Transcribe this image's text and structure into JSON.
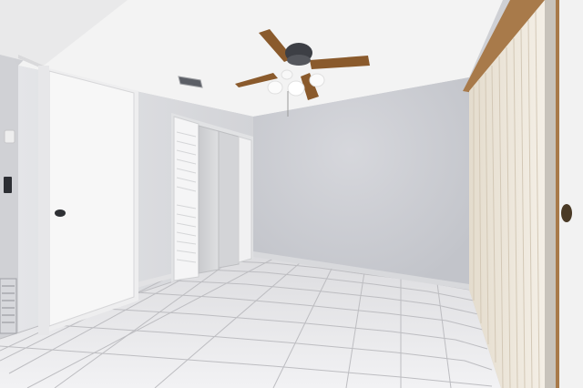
{
  "scene": {
    "type": "photo",
    "room": "empty-bedroom",
    "objects": [
      "ceiling-fan",
      "air-vent",
      "closet-door",
      "mirrored-sliding-closet",
      "louvered-closet-door",
      "vertical-blinds",
      "ceramic-tile-floor",
      "door-knob",
      "thermostat",
      "light-switch",
      "floor-vent"
    ]
  },
  "colors": {
    "ceiling": "#f4f4f4",
    "wall_back": "#c9cbd1",
    "wall_left": "#dcdde0",
    "floor_tile": "#eaeaec",
    "grout": "#b8b8bc",
    "door": "#f6f6f6",
    "blinds": "#efe8dc",
    "wood_trim": "#a87a4a",
    "fan_blade": "#8a5a2c"
  }
}
